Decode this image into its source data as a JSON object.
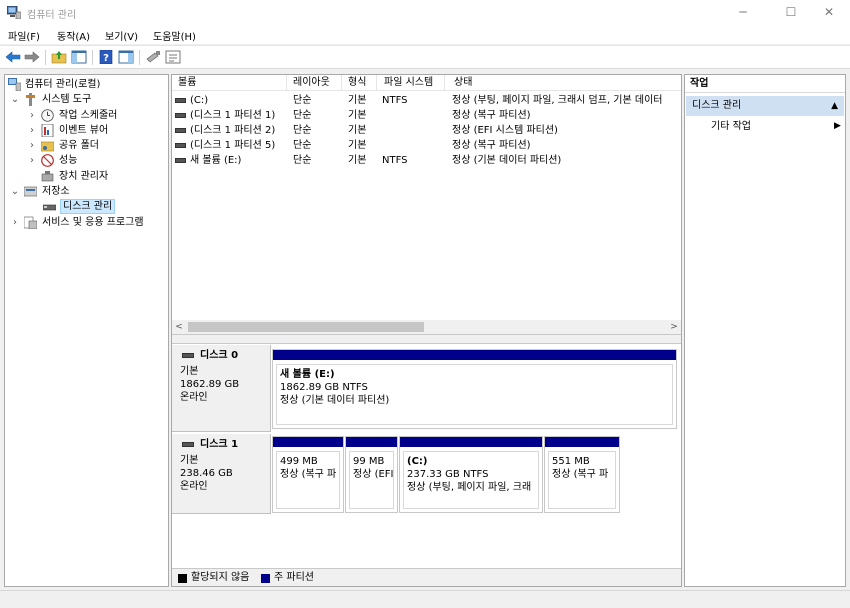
{
  "window": {
    "title": "컴퓨터 관리",
    "min_symbol": "─",
    "max_symbol": "☐",
    "close_symbol": "✕"
  },
  "menu": [
    {
      "label": "파일(F)"
    },
    {
      "label": "동작(A)"
    },
    {
      "label": "보기(V)"
    },
    {
      "label": "도움말(H)"
    }
  ],
  "tree": {
    "root": "컴퓨터 관리(로컬)",
    "system_tools": "시스템 도구",
    "task_scheduler": "작업 스케줄러",
    "event_viewer": "이벤트 뷰어",
    "shared_folders": "공유 폴더",
    "performance": "성능",
    "device_manager": "장치 관리자",
    "storage": "저장소",
    "disk_management": "디스크 관리",
    "services": "서비스 및 응용 프로그램"
  },
  "list": {
    "headers": {
      "volume": "볼륨",
      "layout": "레이아웃",
      "type": "형식",
      "filesystem": "파일 시스템",
      "status": "상태"
    },
    "rows": [
      {
        "volume": "(C:)",
        "layout": "단순",
        "type": "기본",
        "fs": "NTFS",
        "status": "정상 (부팅, 페이지 파일, 크래시 덤프, 기본 데이터"
      },
      {
        "volume": "(디스크 1 파티션 1)",
        "layout": "단순",
        "type": "기본",
        "fs": "",
        "status": "정상 (복구 파티션)"
      },
      {
        "volume": "(디스크 1 파티션 2)",
        "layout": "단순",
        "type": "기본",
        "fs": "",
        "status": "정상 (EFI 시스템 파티션)"
      },
      {
        "volume": "(디스크 1 파티션 5)",
        "layout": "단순",
        "type": "기본",
        "fs": "",
        "status": "정상 (복구 파티션)"
      },
      {
        "volume": "새 볼륨 (E:)",
        "layout": "단순",
        "type": "기본",
        "fs": "NTFS",
        "status": "정상 (기본 데이터 파티션)"
      }
    ],
    "scroll_left": "<",
    "scroll_right": ">"
  },
  "disks": [
    {
      "name": "디스크 0",
      "kind": "기본",
      "size": "1862.89 GB",
      "state": "온라인",
      "partitions": [
        {
          "name": "새 볼륨  (E:)",
          "line1": "1862.89 GB NTFS",
          "line2": "정상 (기본 데이터 파티션)"
        }
      ]
    },
    {
      "name": "디스크 1",
      "kind": "기본",
      "size": "238.46 GB",
      "state": "온라인",
      "partitions": [
        {
          "name": "",
          "line1": "499 MB",
          "line2": "정상 (복구 파"
        },
        {
          "name": "",
          "line1": "99 MB",
          "line2": "정상 (EFI"
        },
        {
          "name": "(C:)",
          "line1": "237.33 GB NTFS",
          "line2": "정상 (부팅, 페이지 파일, 크래"
        },
        {
          "name": "",
          "line1": "551 MB",
          "line2": "정상 (복구 파"
        }
      ]
    }
  ],
  "legend": {
    "unallocated": "할당되지 않음",
    "primary": "주 파티션",
    "unallocated_color": "#000000",
    "primary_color": "#00008b"
  },
  "actions": {
    "header": "작업",
    "section": "디스크 관리",
    "section_caret": "▲",
    "item": "기타 작업",
    "item_caret": "▶"
  }
}
